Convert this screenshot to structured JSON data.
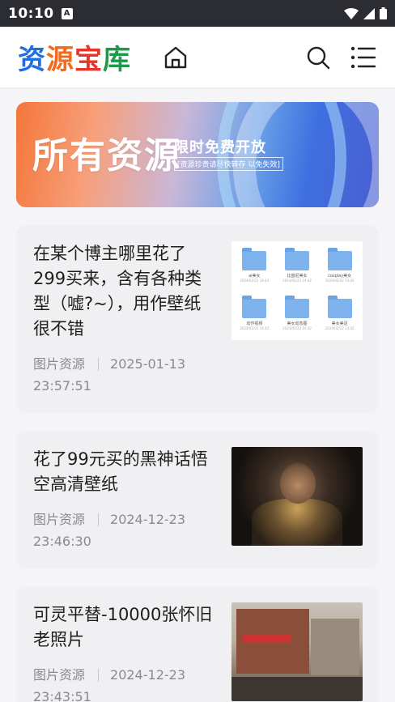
{
  "status_bar": {
    "time": "10:10",
    "notification_icon_letter": "A"
  },
  "header": {
    "logo_chars": [
      "资",
      "源",
      "宝",
      "库"
    ],
    "logo_colors": [
      "#1f6fe0",
      "#f26a1b",
      "#e8352b",
      "#1b9a4a"
    ]
  },
  "banner": {
    "title": "所有资源",
    "subtitle": "限时免费开放",
    "note": "[资源珍贵请尽快转存 以免失效]"
  },
  "posts": [
    {
      "title": "在某个博主哪里花了299买来，含有各种类型（嘘?~），用作壁纸很不错",
      "category": "图片资源",
      "date": "2025-01-13",
      "time": "23:57:51",
      "thumb": "folders",
      "folders": [
        {
          "label": "ai美女",
          "date": "2024/02/22 14:42"
        },
        {
          "label": "比基尼美女",
          "date": "2024/02/22 14:42"
        },
        {
          "label": "cosplay美女",
          "date": "2024/02/22 14:42"
        },
        {
          "label": "动作视频",
          "date": "2024/02/22 14:42"
        },
        {
          "label": "美女动态图",
          "date": "2024/02/22 14:42"
        },
        {
          "label": "美女美足",
          "date": "2024/02/22 14:42"
        }
      ]
    },
    {
      "title": "花了99元买的黑神话悟空高清壁纸",
      "category": "图片资源",
      "date": "2024-12-23",
      "time": "23:46:30",
      "thumb": "wukong"
    },
    {
      "title": "可灵平替-10000张怀旧老照片",
      "category": "图片资源",
      "date": "2024-12-23",
      "time": "23:43:51",
      "thumb": "street"
    }
  ],
  "icons": {
    "home": "home-icon",
    "search": "search-icon",
    "menu": "list-menu-icon"
  }
}
